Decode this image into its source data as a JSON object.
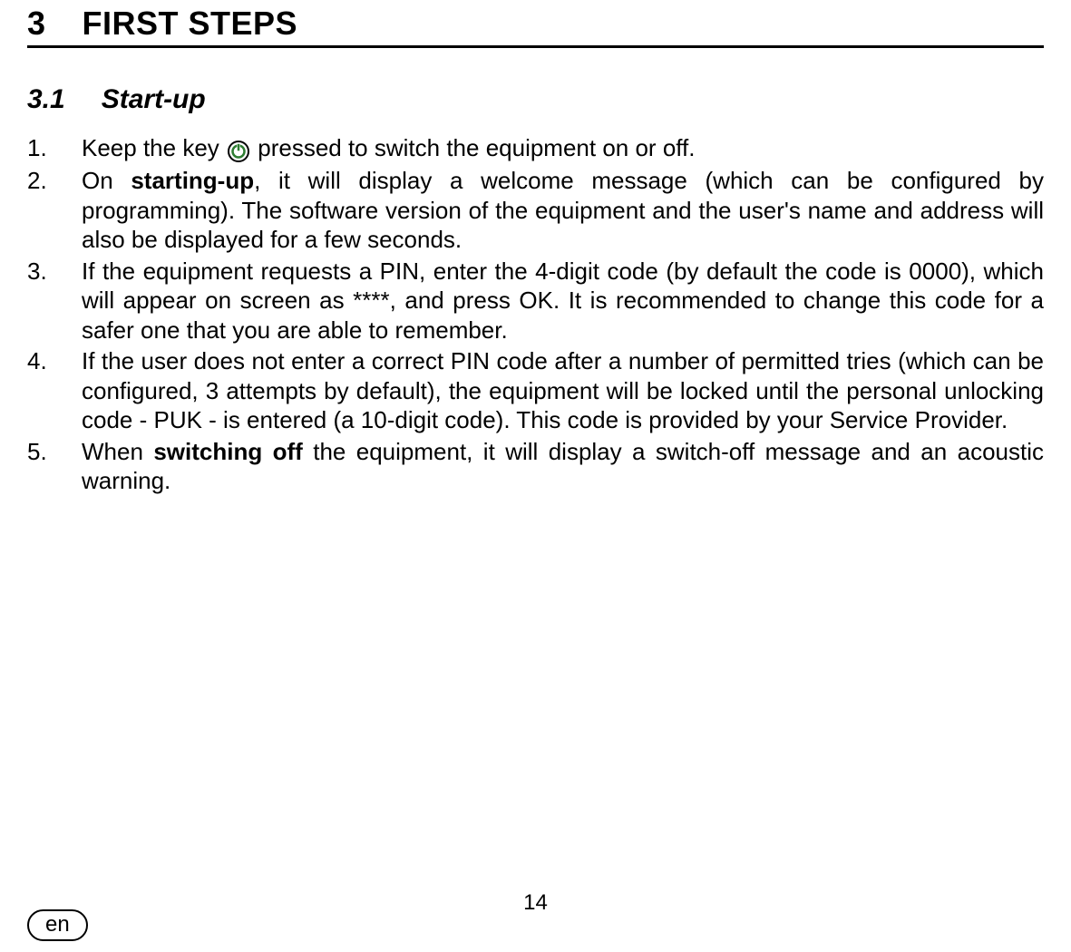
{
  "section": {
    "number": "3",
    "title": "FIRST STEPS"
  },
  "subsection": {
    "number": "3.1",
    "title": "Start-up"
  },
  "steps": {
    "s1": {
      "marker": "1.",
      "t1": "Keep the key ",
      "t2": " pressed to switch the equipment on or off."
    },
    "s2": {
      "marker": "2.",
      "t1": "On ",
      "bold": "starting-up",
      "t2": ", it will display a welcome message (which can be configured by programming). The software version of the equipment and the user's name and address will also be displayed for a few seconds."
    },
    "s3": {
      "marker": "3.",
      "t1": "If the equipment requests a PIN, enter the 4-digit code (by default the code is 0000), which will appear on screen as ****, and press OK. It is recommended to change this code for a safer one that you are able to remember."
    },
    "s4": {
      "marker": "4.",
      "t1": "If the user does not enter a correct PIN code after a number of permitted tries (which can be configured, 3 attempts by default), the equipment will be locked until the personal unlocking code - PUK - is entered (a 10-digit code). This code is provided by your Service Provider."
    },
    "s5": {
      "marker": "5.",
      "t1": "When ",
      "bold": "switching off",
      "t2": " the equipment, it will display a switch-off message and an acoustic warning."
    }
  },
  "page_number": "14",
  "lang": "en"
}
